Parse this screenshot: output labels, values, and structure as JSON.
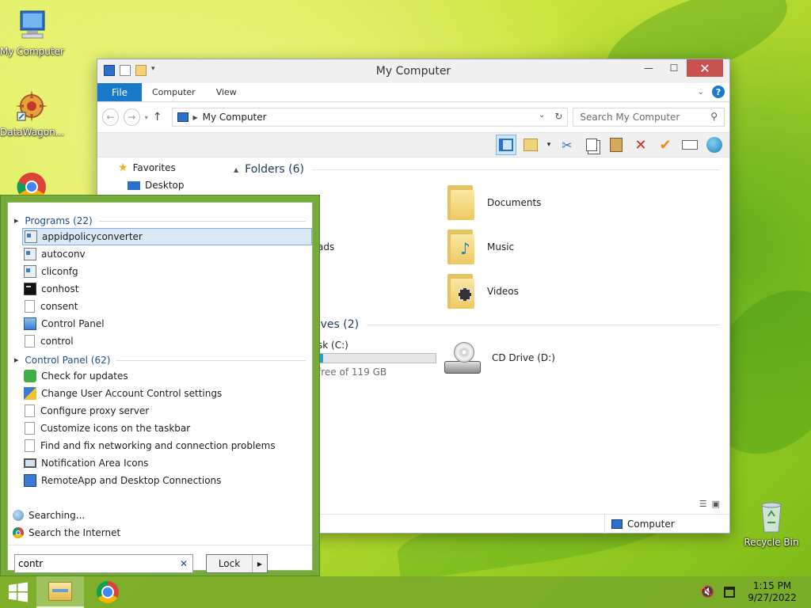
{
  "desktop": {
    "icons": [
      {
        "label": "My Computer"
      },
      {
        "label": "DataWagon..."
      },
      {
        "label": "Recycle Bin"
      }
    ]
  },
  "explorer": {
    "title": "My Computer",
    "ribbon_tabs": [
      "File",
      "Computer",
      "View"
    ],
    "address": "My Computer",
    "search_placeholder": "Search My Computer",
    "nav_pane": {
      "favorites": "Favorites",
      "desktop": "Desktop"
    },
    "folders_header": "Folders (6)",
    "folders": [
      {
        "name": "Documents"
      },
      {
        "name": "Music"
      },
      {
        "name": "Videos"
      },
      {
        "name": "ads"
      }
    ],
    "drives_header": "rives (2)",
    "drives": [
      {
        "name": "sk (C:)",
        "free_text": "free of 119 GB",
        "used_fraction": 0.04
      },
      {
        "name": "CD Drive (D:)"
      }
    ],
    "status_location": "Computer"
  },
  "start_menu": {
    "programs_header": "Programs (22)",
    "programs": [
      {
        "label": "appidpolicyconverter",
        "icon": "app"
      },
      {
        "label": "autoconv",
        "icon": "app"
      },
      {
        "label": "cliconfg",
        "icon": "app"
      },
      {
        "label": "conhost",
        "icon": "cmd"
      },
      {
        "label": "consent",
        "icon": "page"
      },
      {
        "label": "Control Panel",
        "icon": "control-panel"
      },
      {
        "label": "control",
        "icon": "page"
      }
    ],
    "control_panel_header": "Control Panel (62)",
    "control_panel_items": [
      {
        "label": "Check for updates",
        "icon": "update"
      },
      {
        "label": "Change User Account Control settings",
        "icon": "flag"
      },
      {
        "label": "Configure proxy server",
        "icon": "page"
      },
      {
        "label": "Customize icons on the taskbar",
        "icon": "page"
      },
      {
        "label": "Find and fix networking and connection problems",
        "icon": "page"
      },
      {
        "label": "Notification Area Icons",
        "icon": "monitor"
      },
      {
        "label": "RemoteApp and Desktop Connections",
        "icon": "remote"
      }
    ],
    "searching": "Searching...",
    "search_internet": "Search the Internet",
    "search_value": "contr",
    "lock_label": "Lock"
  },
  "taskbar": {
    "time": "1:15 PM",
    "date": "9/27/2022"
  },
  "colors": {
    "accent": "#1979ca",
    "start_menu_frame": "#74ab3b",
    "taskbar": "#78aa28"
  }
}
